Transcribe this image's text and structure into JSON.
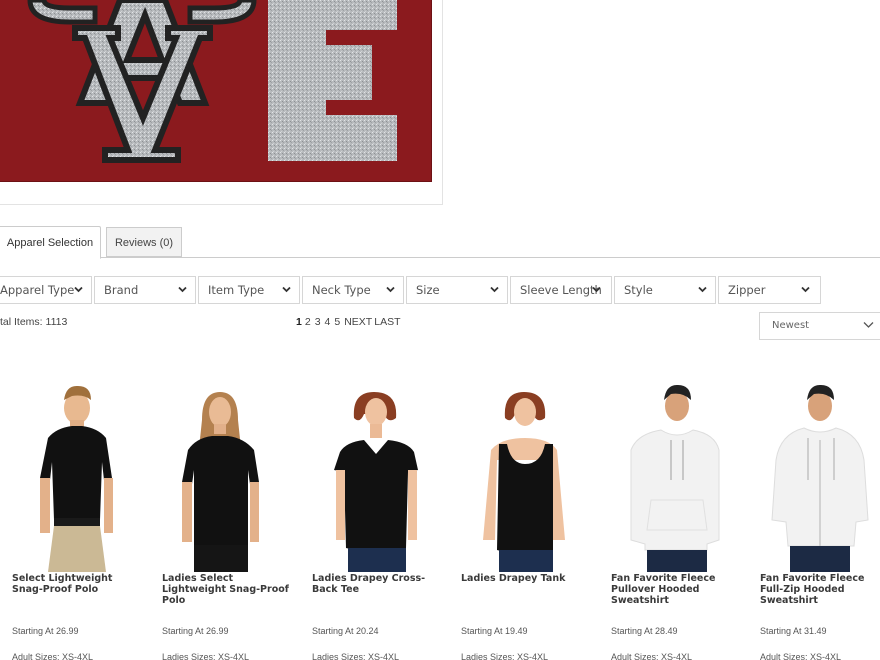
{
  "banner": {
    "alt": "VE school logo banner",
    "colors": {
      "background": "#8b1a1e",
      "glitter": "#b9bcbf",
      "outline": "#2a2a2a"
    }
  },
  "tabs": [
    {
      "label": "Apparel Selection",
      "active": true
    },
    {
      "label": "Reviews (0)",
      "active": false
    }
  ],
  "filters": [
    {
      "label": "Apparel Type"
    },
    {
      "label": "Brand"
    },
    {
      "label": "Item Type"
    },
    {
      "label": "Neck Type"
    },
    {
      "label": "Size"
    },
    {
      "label": "Sleeve Length"
    },
    {
      "label": "Style"
    },
    {
      "label": "Zipper"
    }
  ],
  "listing": {
    "total_label": "tal Items: 1113",
    "pagination": {
      "pages": [
        "1",
        "2",
        "3",
        "4",
        "5"
      ],
      "current": "1",
      "next": "NEXT",
      "last": "LAST"
    },
    "sort": {
      "selected": "Newest"
    }
  },
  "products": [
    {
      "name": "Select Lightweight Snag-Proof Polo",
      "price": "Starting At 26.99",
      "sizes": "Adult Sizes: XS-4XL",
      "image": "man-black-polo"
    },
    {
      "name": "Ladies Select Lightweight Snag-Proof Polo",
      "price": "Starting At 26.99",
      "sizes": "Ladies Sizes: XS-4XL",
      "image": "woman-black-polo"
    },
    {
      "name": "Ladies Drapey Cross-Back Tee",
      "price": "Starting At 20.24",
      "sizes": "Ladies Sizes: XS-4XL",
      "image": "woman-black-tee"
    },
    {
      "name": "Ladies Drapey Tank",
      "price": "Starting At 19.49",
      "sizes": "Ladies Sizes: XS-4XL",
      "image": "woman-black-tank"
    },
    {
      "name": "Fan Favorite Fleece Pullover Hooded Sweatshirt",
      "price": "Starting At 28.49",
      "sizes": "Adult Sizes: XS-4XL",
      "image": "man-white-hoodie"
    },
    {
      "name": "Fan Favorite Fleece Full-Zip Hooded Sweatshirt",
      "price": "Starting At 31.49",
      "sizes": "Adult Sizes: XS-4XL",
      "image": "man-white-zip-hoodie"
    }
  ]
}
